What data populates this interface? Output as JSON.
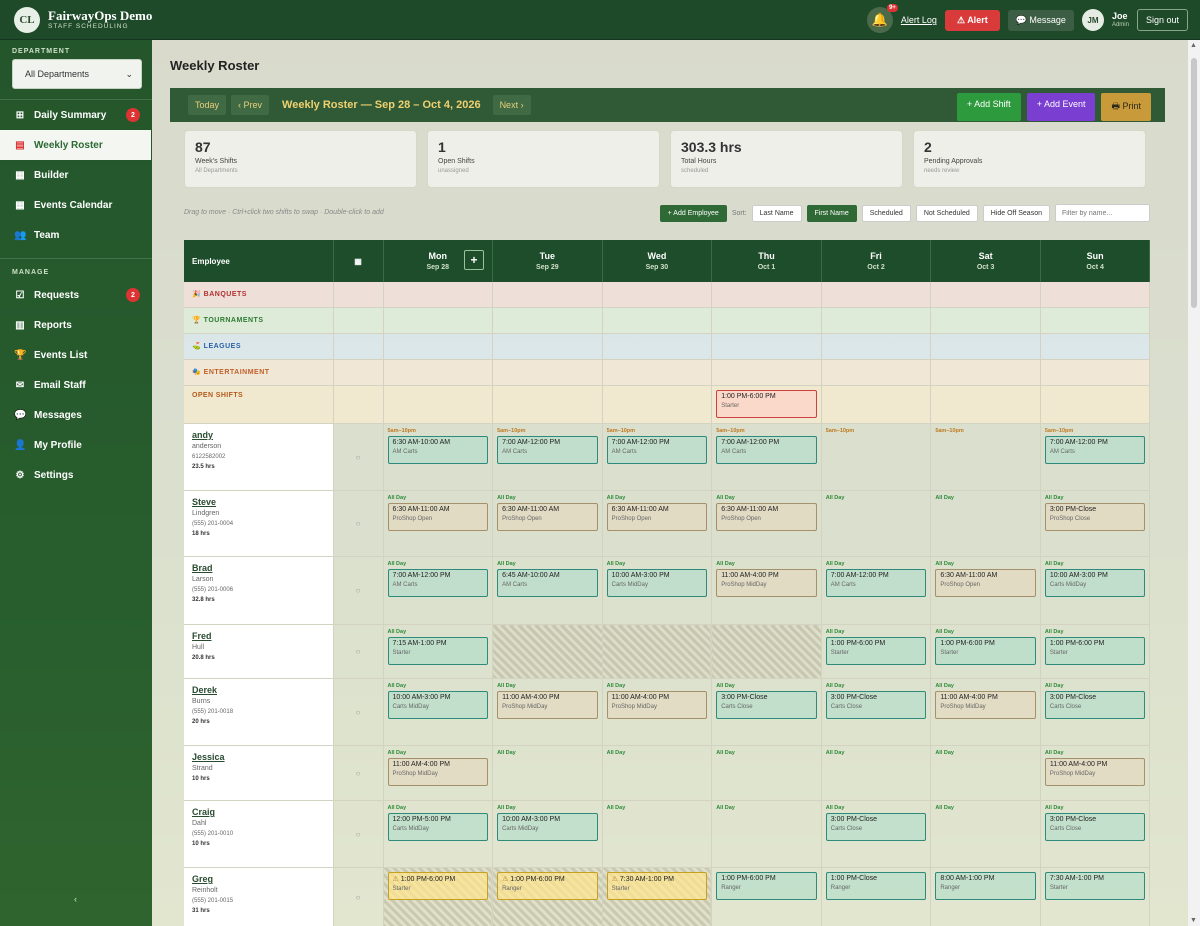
{
  "app": {
    "logo_initials": "CL",
    "name": "FairwayOps Demo",
    "subtitle": "STAFF SCHEDULING"
  },
  "topbar": {
    "bell_badge": "9+",
    "alert_log": "Alert Log",
    "alert": "Alert",
    "message": "Message",
    "user_initials": "JM",
    "user_name": "Joe",
    "user_role": "Admin",
    "sign_out": "Sign out"
  },
  "sidebar": {
    "department_label": "DEPARTMENT",
    "department_value": "All Departments",
    "manage_label": "MANAGE",
    "items": [
      {
        "label": "Daily Summary",
        "icon": "grid-icon",
        "badge": "2"
      },
      {
        "label": "Weekly Roster",
        "icon": "clipboard-icon",
        "badge": ""
      },
      {
        "label": "Builder",
        "icon": "calendar-icon",
        "badge": ""
      },
      {
        "label": "Events Calendar",
        "icon": "calendar-icon",
        "badge": ""
      },
      {
        "label": "Team",
        "icon": "team-icon",
        "badge": ""
      }
    ],
    "manage_items": [
      {
        "label": "Requests",
        "icon": "check-icon",
        "badge": "2"
      },
      {
        "label": "Reports",
        "icon": "chart-icon",
        "badge": ""
      },
      {
        "label": "Events List",
        "icon": "trophy-icon",
        "badge": ""
      },
      {
        "label": "Email Staff",
        "icon": "mail-icon",
        "badge": ""
      },
      {
        "label": "Messages",
        "icon": "chat-icon",
        "badge": ""
      },
      {
        "label": "My Profile",
        "icon": "user-icon",
        "badge": ""
      },
      {
        "label": "Settings",
        "icon": "gear-icon",
        "badge": ""
      }
    ]
  },
  "page": {
    "title": "Weekly Roster"
  },
  "roster_bar": {
    "today": "Today",
    "prev": "‹ Prev",
    "title": "Weekly Roster — Sep 28 – Oct 4, 2026",
    "next": "Next ›",
    "add_shift": "+ Add Shift",
    "add_event": "+ Add Event",
    "print": "Print"
  },
  "stats": [
    {
      "value": "87",
      "label": "Week's Shifts",
      "sub": "All Departments"
    },
    {
      "value": "1",
      "label": "Open Shifts",
      "sub": "unassigned"
    },
    {
      "value": "303.3 hrs",
      "label": "Total Hours",
      "sub": "scheduled"
    },
    {
      "value": "2",
      "label": "Pending Approvals",
      "sub": "needs review"
    }
  ],
  "toolbar": {
    "hint": "Drag to move · Ctrl+click two shifts to swap · Double-click to add",
    "add_employee": "+ Add Employee",
    "sort_label": "Sort:",
    "sort_options": [
      "Last Name",
      "First Name",
      "Scheduled",
      "Not Scheduled",
      "Hide Off Season"
    ],
    "filter_placeholder": "Filter by name..."
  },
  "grid": {
    "employee_header": "Employee",
    "days": [
      {
        "day": "Mon",
        "date": "Sep 28"
      },
      {
        "day": "Tue",
        "date": "Sep 29"
      },
      {
        "day": "Wed",
        "date": "Sep 30"
      },
      {
        "day": "Thu",
        "date": "Oct 1"
      },
      {
        "day": "Fri",
        "date": "Oct 2"
      },
      {
        "day": "Sat",
        "date": "Oct 3"
      },
      {
        "day": "Sun",
        "date": "Oct 4"
      }
    ],
    "categories": [
      "BANQUETS",
      "TOURNAMENTS",
      "LEAGUES",
      "ENTERTAINMENT"
    ],
    "open_shifts_label": "OPEN SHIFTS",
    "open_shift": {
      "time": "1:00 PM-6:00 PM",
      "role": "Starter"
    },
    "employees": [
      {
        "first": "andy",
        "last": "anderson",
        "phone": "6122582002",
        "hours": "23.5 hrs"
      },
      {
        "first": "Steve",
        "last": "Lindgren",
        "phone": "(555) 201-0004",
        "hours": "18 hrs"
      },
      {
        "first": "Brad",
        "last": "Larson",
        "phone": "(555) 201-0006",
        "hours": "32.8 hrs"
      },
      {
        "first": "Fred",
        "last": "Hull",
        "phone": "",
        "hours": "20.8 hrs"
      },
      {
        "first": "Derek",
        "last": "Burns",
        "phone": "(555) 201-0018",
        "hours": "20 hrs"
      },
      {
        "first": "Jessica",
        "last": "Strand",
        "phone": "",
        "hours": "10 hrs"
      },
      {
        "first": "Craig",
        "last": "Dahl",
        "phone": "(555) 201-0010",
        "hours": "10 hrs"
      },
      {
        "first": "Greg",
        "last": "Reinholt",
        "phone": "(555) 201-0015",
        "hours": "31 hrs"
      }
    ],
    "avail_allday": "All Day",
    "avail_andy": "5am–10pm",
    "shifts": {
      "r0": [
        {
          "t": "6:30 AM-10:00 AM",
          "r": "AM Carts"
        },
        {
          "t": "7:00 AM-12:00 PM",
          "r": "AM Carts"
        },
        {
          "t": "7:00 AM-12:00 PM",
          "r": "AM Carts"
        },
        {
          "t": "7:00 AM-12:00 PM",
          "r": "AM Carts"
        },
        {
          "t": "7:00 AM-12:00 PM",
          "r": "AM Carts"
        }
      ],
      "r1": [
        {
          "t": "6:30 AM-11:00 AM",
          "r": "ProShop Open"
        },
        {
          "t": "6:30 AM-11:00 AM",
          "r": "ProShop Open"
        },
        {
          "t": "6:30 AM-11:00 AM",
          "r": "ProShop Open"
        },
        {
          "t": "6:30 AM-11:00 AM",
          "r": "ProShop Open"
        },
        {
          "t": "3:00 PM-Close",
          "r": "ProShop Close"
        }
      ],
      "r2": [
        {
          "t": "7:00 AM-12:00 PM",
          "r": "AM Carts"
        },
        {
          "t": "6:45 AM-10:00 AM",
          "r": "AM Carts"
        },
        {
          "t": "10:00 AM-3:00 PM",
          "r": "Carts MidDay"
        },
        {
          "t": "11:00 AM-4:00 PM",
          "r": "ProShop MidDay"
        },
        {
          "t": "7:00 AM-12:00 PM",
          "r": "AM Carts"
        },
        {
          "t": "6:30 AM-11:00 AM",
          "r": "ProShop Open"
        },
        {
          "t": "10:00 AM-3:00 PM",
          "r": "Carts MidDay"
        }
      ],
      "r3": [
        {
          "t": "7:15 AM-1:00 PM",
          "r": "Starter"
        },
        {
          "t": "1:00 PM-6:00 PM",
          "r": "Starter"
        },
        {
          "t": "1:00 PM-6:00 PM",
          "r": "Starter"
        },
        {
          "t": "1:00 PM-6:00 PM",
          "r": "Starter"
        }
      ],
      "r4": [
        {
          "t": "10:00 AM-3:00 PM",
          "r": "Carts MidDay"
        },
        {
          "t": "11:00 AM-4:00 PM",
          "r": "ProShop MidDay"
        },
        {
          "t": "11:00 AM-4:00 PM",
          "r": "ProShop MidDay"
        },
        {
          "t": "3:00 PM-Close",
          "r": "Carts Close"
        },
        {
          "t": "3:00 PM-Close",
          "r": "Carts Close"
        },
        {
          "t": "11:00 AM-4:00 PM",
          "r": "ProShop MidDay"
        },
        {
          "t": "3:00 PM-Close",
          "r": "Carts Close"
        }
      ],
      "r5": [
        {
          "t": "11:00 AM-4:00 PM",
          "r": "ProShop MidDay"
        },
        {
          "t": "11:00 AM-4:00 PM",
          "r": "ProShop MidDay"
        }
      ],
      "r6": [
        {
          "t": "12:00 PM-5:00 PM",
          "r": "Carts MidDay"
        },
        {
          "t": "10:00 AM-3:00 PM",
          "r": "Carts MidDay"
        },
        {
          "t": "3:00 PM-Close",
          "r": "Carts Close"
        },
        {
          "t": "3:00 PM-Close",
          "r": "Carts Close"
        }
      ],
      "r7": [
        {
          "t": "1:00 PM-6:00 PM",
          "r": "Starter"
        },
        {
          "t": "1:00 PM-6:00 PM",
          "r": "Ranger"
        },
        {
          "t": "7:30 AM-1:00 PM",
          "r": "Starter"
        },
        {
          "t": "1:00 PM-6:00 PM",
          "r": "Ranger"
        },
        {
          "t": "1:00 PM-Close",
          "r": "Ranger"
        },
        {
          "t": "8:00 AM-1:00 PM",
          "r": "Ranger"
        },
        {
          "t": "7:30 AM-1:00 PM",
          "r": "Starter"
        }
      ]
    }
  }
}
